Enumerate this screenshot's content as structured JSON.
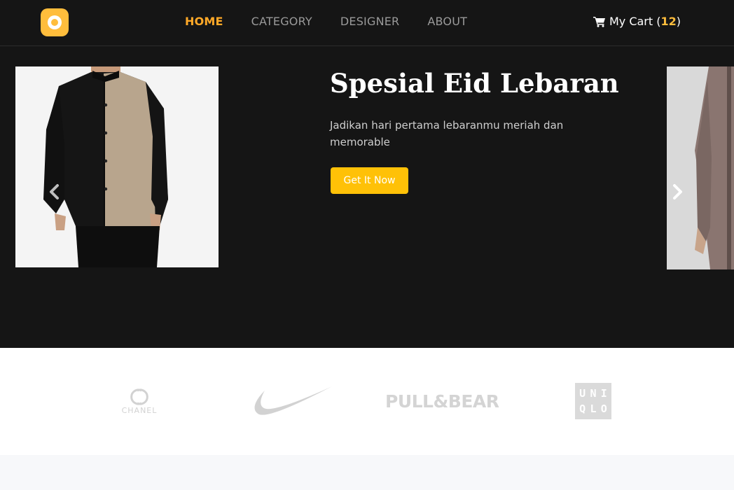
{
  "nav": {
    "items": [
      {
        "label": "HOME",
        "active": true
      },
      {
        "label": "CATEGORY",
        "active": false
      },
      {
        "label": "DESIGNER",
        "active": false
      },
      {
        "label": "ABOUT",
        "active": false
      }
    ],
    "cart": {
      "label": "My Cart",
      "open": "(",
      "count": "12",
      "close": ")",
      "icon": "shopping-cart-icon"
    }
  },
  "hero": {
    "title": "Spesial Eid Lebaran",
    "description": "Jadikan hari pertama lebaranmu meriah dan memorable",
    "cta_label": "Get It Now",
    "prev_icon": "chevron-left-icon",
    "next_icon": "chevron-right-icon"
  },
  "brands": {
    "chanel": "CHANEL",
    "pullbear": "PULL&BEAR",
    "uniqlo": [
      "U",
      "N",
      "I",
      "Q",
      "L",
      "O"
    ]
  },
  "colors": {
    "accent": "#ffa928",
    "logo": "#ffbd3c",
    "button": "#ffc107",
    "navbar_bg": "#151515",
    "brand_gray": "#d4d4d4"
  }
}
